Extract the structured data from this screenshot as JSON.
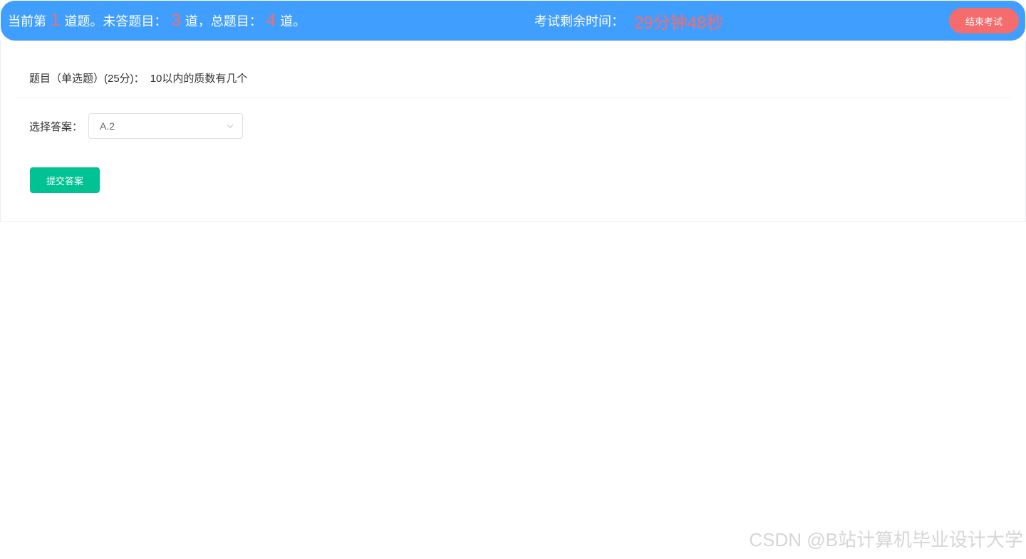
{
  "header": {
    "current_prefix": "当前第",
    "current_num": "1",
    "current_suffix": "道题。未答题目：",
    "unanswered_num": "3",
    "unanswered_suffix": "道，总题目：",
    "total_num": "4",
    "total_suffix": "道。",
    "timer_label": "考试剩余时间：",
    "timer_value": "29分钟48秒",
    "end_button_label": "结束考试"
  },
  "question": {
    "prefix": "题目（单选题）(25分)：",
    "text": "10以内的质数有几个"
  },
  "answer": {
    "label": "选择答案：",
    "selected": "A.2"
  },
  "submit_label": "提交答案",
  "watermark": "CSDN @B站计算机毕业设计大学",
  "colors": {
    "header_bg": "#409EFF",
    "highlight": "#F56C6C",
    "end_button": "#F56C6C",
    "submit_button": "#00C292"
  }
}
